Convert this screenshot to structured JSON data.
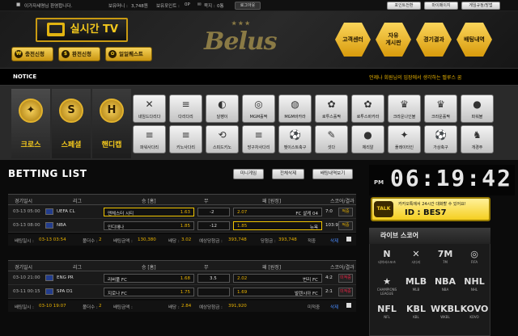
{
  "topbar": {
    "greeting": "이가자세명님 환영합니다.",
    "money_label": "보유머니 :",
    "money": "3,748원",
    "point_label": "보유포인트 :",
    "point": "0P",
    "note_label": "쪽지 :",
    "note": "0통",
    "logout": "로그아웃",
    "point_exchange": "포인트전환",
    "mypage": "마이페이지",
    "rules": "게임규정/방법"
  },
  "header": {
    "tv_label": "실시간 TV",
    "deposit": "충전신청",
    "withdraw": "환전신청",
    "attendance": "일일퀘스트",
    "logo": "Belus",
    "hex_buttons": [
      "고객센터",
      "자유\n게시판",
      "경기결과",
      "배팅내역"
    ]
  },
  "notice": {
    "label": "NOTICE",
    "text": "언제나 회원님의 입장에서 생각하는 벨루스 꿈"
  },
  "nav": {
    "big_tabs": [
      {
        "label": "크로스",
        "icon": "✦",
        "name": "cross"
      },
      {
        "label": "스페셜",
        "icon": "S",
        "name": "special"
      },
      {
        "label": "핸디캡",
        "icon": "H",
        "name": "handicap"
      }
    ],
    "games_row1": [
      "네임드다리다",
      "다리다리",
      "달팽이",
      "MGM홀짝",
      "MGM바카라",
      "로투스홀짝",
      "로투스바카라",
      "크라운나인볼",
      "크라운홀짝",
      "파워볼"
    ],
    "games_row2": [
      "파워사다리",
      "키노사다리",
      "스피드키노",
      "방구차사다리",
      "벳이스트축구",
      "섯다",
      "체리알",
      "플레이타인",
      "가상축구",
      "개경주"
    ]
  },
  "betting": {
    "title": "BETTING LIST",
    "btn_mygame": "미니게임",
    "btn_delete_all": "전체삭제",
    "btn_history": "배팅내역보기",
    "headers": [
      "경기일시",
      "리그",
      "승 [홈]",
      "무",
      "패 [원정]",
      "스코어/결과"
    ],
    "groups": [
      {
        "rows": [
          {
            "time": "03-13 05:00",
            "league": "UEFA CL",
            "home": "맨체스터 시티",
            "home_odds": "1.63",
            "draw": "-2",
            "away_odds": "2.07",
            "away": "FC 샬케 04",
            "score": "7:0",
            "result": "적중"
          },
          {
            "time": "03-13 08:00",
            "league": "NBA",
            "home": "인디애나",
            "home_odds": "1.85",
            "draw": "-12",
            "away_odds": "1.85",
            "away": "뉴욕",
            "score": "103:98",
            "result": "적중"
          }
        ],
        "summary": {
          "bet_time_label": "배팅일시 :",
          "bet_time": "03-13 03:54",
          "folder_label": "폴더수 :",
          "folder": "2",
          "bet_amount_label": "배팅금액 :",
          "bet_amount": "130,380",
          "odds_label": "배당 :",
          "odds": "3.02",
          "expect_label": "예상당첨금 :",
          "expect": "393,748",
          "win_label": "당첨금 :",
          "win": "393,748",
          "status": "적중",
          "delete": "삭제"
        }
      },
      {
        "rows": [
          {
            "time": "03-10 21:00",
            "league": "ENG PR",
            "home": "리버풀 FC",
            "home_odds": "1.68",
            "draw": "3.5",
            "away_odds": "2.02",
            "away": "번리 FC",
            "score": "4:2",
            "result": "미적중"
          },
          {
            "time": "03-11 00:15",
            "league": "SPA D1",
            "home": "지로나 FC",
            "home_odds": "1.75",
            "draw": "",
            "away_odds": "1.69",
            "away": "발렌시아 FC",
            "score": "2:1",
            "result": "미적중"
          }
        ],
        "summary": {
          "bet_time_label": "배팅일시 :",
          "bet_time": "03-10 19:07",
          "folder_label": "폴더수 :",
          "folder": "2",
          "bet_amount_label": "배팅금액 :",
          "bet_amount": "",
          "odds_label": "배당 :",
          "odds": "2.84",
          "expect_label": "예상당첨금 :",
          "expect": "391,920",
          "win_label": "",
          "win": "",
          "status": "미적중",
          "delete": "삭제"
        }
      }
    ]
  },
  "right": {
    "pm": "PM",
    "clock": "06:19:42",
    "kakao_line1": "카카오톡에서 24시간 대화할 수 있어요!",
    "kakao_id": "ID : BES7",
    "kakao_icon": "TALK",
    "live_title": "라이브 스코어",
    "leagues": [
      {
        "icon": "N",
        "name": "네이버스포츠"
      },
      {
        "icon": "✕",
        "name": "사다리"
      },
      {
        "icon": "7M",
        "name": "7M"
      },
      {
        "icon": "◎",
        "name": "FIFA"
      },
      {
        "icon": "★",
        "name": "CHAMPIONS LEAGUE"
      },
      {
        "icon": "MLB",
        "name": "MLB"
      },
      {
        "icon": "NBA",
        "name": "NBA"
      },
      {
        "icon": "NHL",
        "name": "NHL"
      },
      {
        "icon": "NFL",
        "name": "NFL"
      },
      {
        "icon": "KBL",
        "name": "KBL"
      },
      {
        "icon": "WKBL",
        "name": "WKBL"
      },
      {
        "icon": "KOVO",
        "name": "KOVO"
      }
    ]
  }
}
